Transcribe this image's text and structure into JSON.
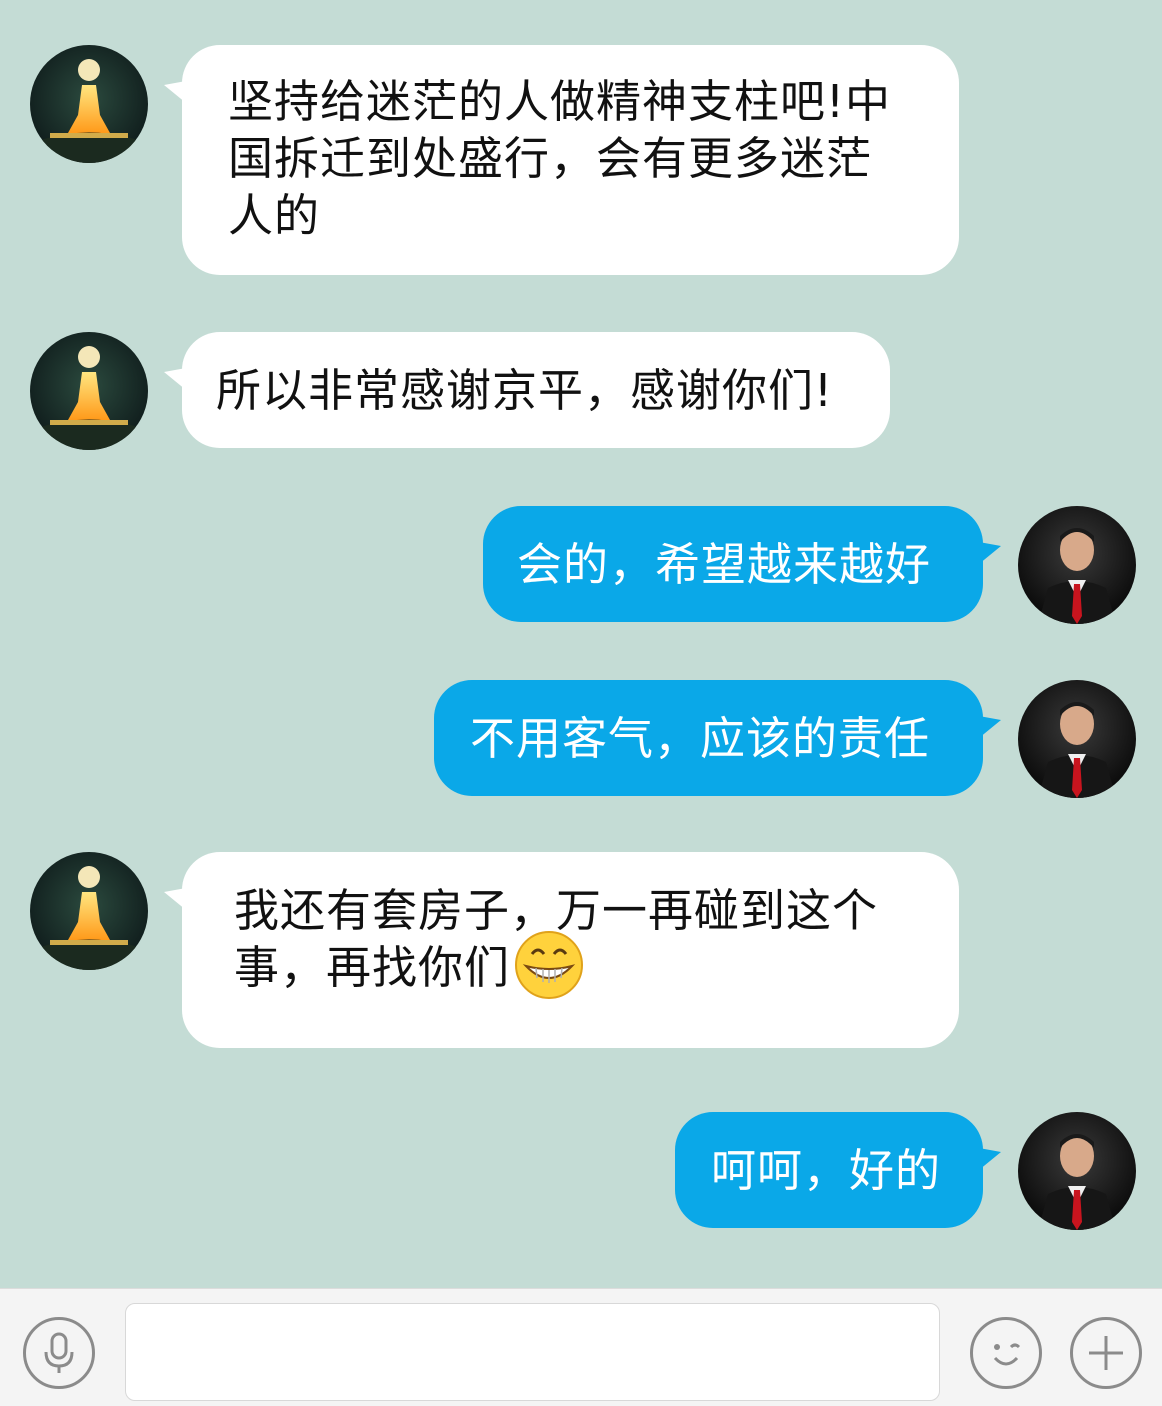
{
  "messages": [
    {
      "side": "in",
      "text": "坚持给迷茫的人做精神支柱吧!中\n国拆迁到处盛行，会有更多迷茫\n人的"
    },
    {
      "side": "in",
      "text": "所以非常感谢京平，感谢你们!"
    },
    {
      "side": "out",
      "text": "会的，希望越来越好"
    },
    {
      "side": "out",
      "text": "不用客气，应该的责任"
    },
    {
      "side": "in",
      "text": "我还有套房子，万一再碰到这个\n事，再找你们",
      "emoji": "grinning-emoji"
    },
    {
      "side": "out",
      "text": "呵呵，好的"
    }
  ],
  "input": {
    "value": "",
    "placeholder": ""
  },
  "icons": {
    "voice": "microphone-icon",
    "emoji": "emoji-face-icon",
    "more": "plus-icon"
  },
  "colors": {
    "background": "#c4dcd5",
    "incoming_bubble": "#ffffff",
    "outgoing_bubble": "#0aa8e8",
    "input_bar": "#f4f4f4"
  }
}
